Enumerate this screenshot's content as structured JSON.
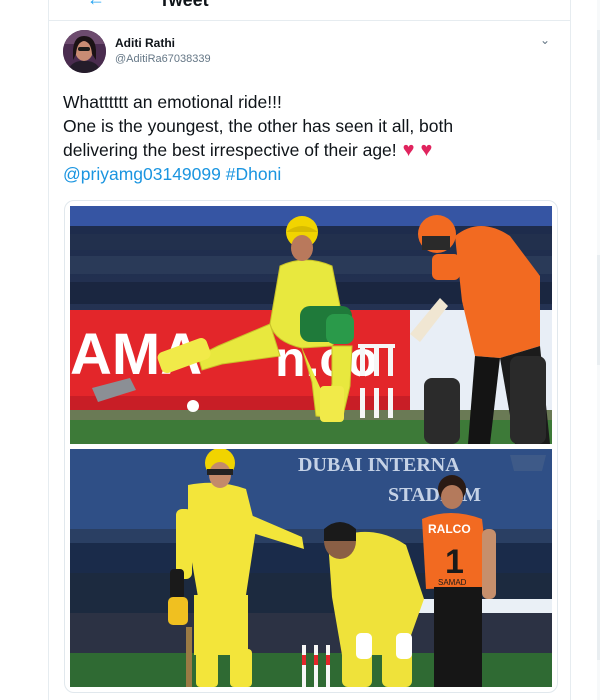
{
  "header": {
    "title": "Tweet"
  },
  "tweet": {
    "author_name": "Aditi Rathi",
    "author_handle": "@AditiRa67038339",
    "lines": [
      "Whatttttt an emotional ride!!!",
      "One is the youngest, the other has seen it all, both",
      "delivering the best irrespective of their age!"
    ],
    "mention": "@priyamg03149099",
    "hashtag": "#Dhoni",
    "heart": "♥",
    "caret": "⌄",
    "back": "←"
  },
  "photos": {
    "top": {
      "banner_text": "AMA",
      "banner_text_2": "n.co"
    },
    "bottom": {
      "stadium_line1": "DUBAI INTERNA",
      "stadium_line2": "STADIUM",
      "jersey_brand": "RALCO",
      "jersey_number": "1",
      "jersey_name": "SAMAD"
    }
  },
  "colors": {
    "accent": "#1da1f2",
    "heart": "#e0245e",
    "csk_yellow": "#e6e33a",
    "srh_orange": "#f26a21"
  }
}
